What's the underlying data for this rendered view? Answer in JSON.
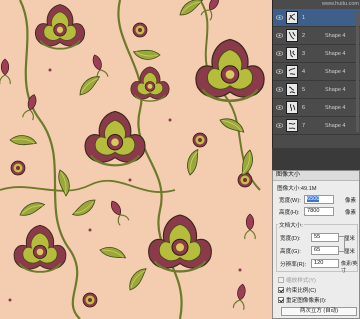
{
  "watermark": "www.huitu.com",
  "layers": {
    "items": [
      {
        "name": "1",
        "tag": "",
        "selected": true
      },
      {
        "name": "2",
        "tag": "Shape 4",
        "selected": false
      },
      {
        "name": "3",
        "tag": "Shape 4",
        "selected": false
      },
      {
        "name": "4",
        "tag": "Shape 4",
        "selected": false
      },
      {
        "name": "5",
        "tag": "Shape 4",
        "selected": false
      },
      {
        "name": "6",
        "tag": "Shape 4",
        "selected": false
      },
      {
        "name": "7",
        "tag": "Shape 4",
        "selected": false
      }
    ]
  },
  "dialog": {
    "title": "图像大小",
    "image_size_label": "图像大小:49.1M",
    "width_label": "宽度(W):",
    "width_value": "6500",
    "width_unit": "像素",
    "height_label": "高度(H):",
    "height_value": "7800",
    "height_unit": "像素",
    "doc_size_label": "文档大小:",
    "doc_width_label": "宽度(D):",
    "doc_width_value": "55",
    "doc_width_unit": "厘米",
    "doc_height_label": "高度(G):",
    "doc_height_value": "65",
    "doc_height_unit": "厘米",
    "resolution_label": "分辨率(R):",
    "resolution_value": "120",
    "resolution_unit": "像素/英寸",
    "scale_styles_label": "缩放样式(Y)",
    "constrain_label": "约束比例(C)",
    "resample_label": "重定图像像素(I):",
    "resample_option": "两次立方 (自动)"
  },
  "colors": {
    "canvas_bg": "#f4cdb1",
    "panel_bg": "#4b4b4b",
    "selected_row": "#3d5f8a",
    "dialog_bg": "#ececec",
    "highlight": "#3875d7"
  }
}
